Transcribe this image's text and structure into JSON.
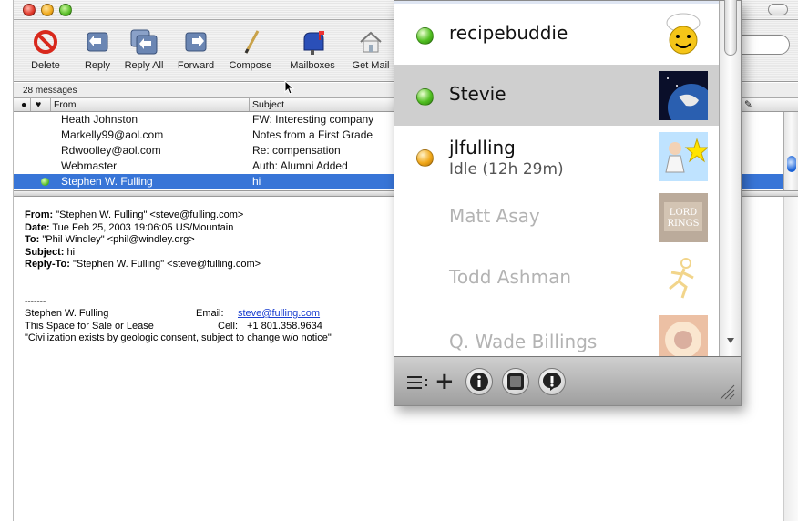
{
  "toolbar": {
    "buttons": [
      {
        "label": "Delete",
        "icon": "delete-icon"
      },
      {
        "label": "Reply",
        "icon": "reply-icon"
      },
      {
        "label": "Reply All",
        "icon": "reply-all-icon"
      },
      {
        "label": "Forward",
        "icon": "forward-icon"
      },
      {
        "label": "Compose",
        "icon": "compose-icon"
      },
      {
        "label": "Mailboxes",
        "icon": "mailboxes-icon"
      },
      {
        "label": "Get Mail",
        "icon": "get-mail-icon"
      }
    ]
  },
  "mailbox": {
    "count_text": "28 messages",
    "columns": {
      "from": "From",
      "subject": "Subject"
    }
  },
  "messages": [
    {
      "from": "Heath Johnston",
      "subject": "FW: Interesting company"
    },
    {
      "from": "Markelly99@aol.com",
      "subject": "Notes from a First Grade"
    },
    {
      "from": "Rdwoolley@aol.com",
      "subject": "Re: compensation"
    },
    {
      "from": "Webmaster",
      "subject": "Auth: Alumni Added"
    },
    {
      "from": "Stephen W. Fulling",
      "subject": "hi",
      "selected": true
    }
  ],
  "preview": {
    "from_label": "From:",
    "from_value": " \"Stephen W. Fulling\" <steve@fulling.com>",
    "date_label": "Date:",
    "date_value": " Tue Feb 25, 2003  19:06:05 US/Mountain",
    "to_label": "To:",
    "to_value": " \"Phil Windley\" <phil@windley.org>",
    "subject_label": "Subject:",
    "subject_value": " hi",
    "replyto_label": "Reply-To:",
    "replyto_value": " \"Stephen W. Fulling\" <steve@fulling.com>",
    "sig_sep": "-------",
    "sig_name": "Stephen W. Fulling",
    "sig_email_label": "Email:",
    "sig_email": "steve@fulling.com",
    "sig_tagline": "This Space for Sale or Lease",
    "sig_cell_label": "Cell:",
    "sig_cell": "+1 801.358.9634",
    "sig_quote": "\"Civilization exists by geologic consent, subject to change w/o notice\""
  },
  "buddies": [
    {
      "name": "recipebuddie",
      "status": "",
      "state": "online"
    },
    {
      "name": "Stevie",
      "status": "",
      "state": "online",
      "selected": true
    },
    {
      "name": "jlfulling",
      "status": "Idle (12h 29m)",
      "state": "idle"
    },
    {
      "name": "Matt Asay",
      "status": "",
      "state": "offline"
    },
    {
      "name": "Todd Ashman",
      "status": "",
      "state": "offline"
    },
    {
      "name": "Q. Wade Billings",
      "status": "",
      "state": "offline"
    }
  ],
  "buddy_toolbar": [
    "list-menu-icon",
    "add-icon",
    "info-icon",
    "chat-icon",
    "alert-icon"
  ],
  "colors": {
    "selection": "#3875d7",
    "link": "#1a3fd0",
    "online": "#52c022",
    "idle": "#f1a91b"
  }
}
